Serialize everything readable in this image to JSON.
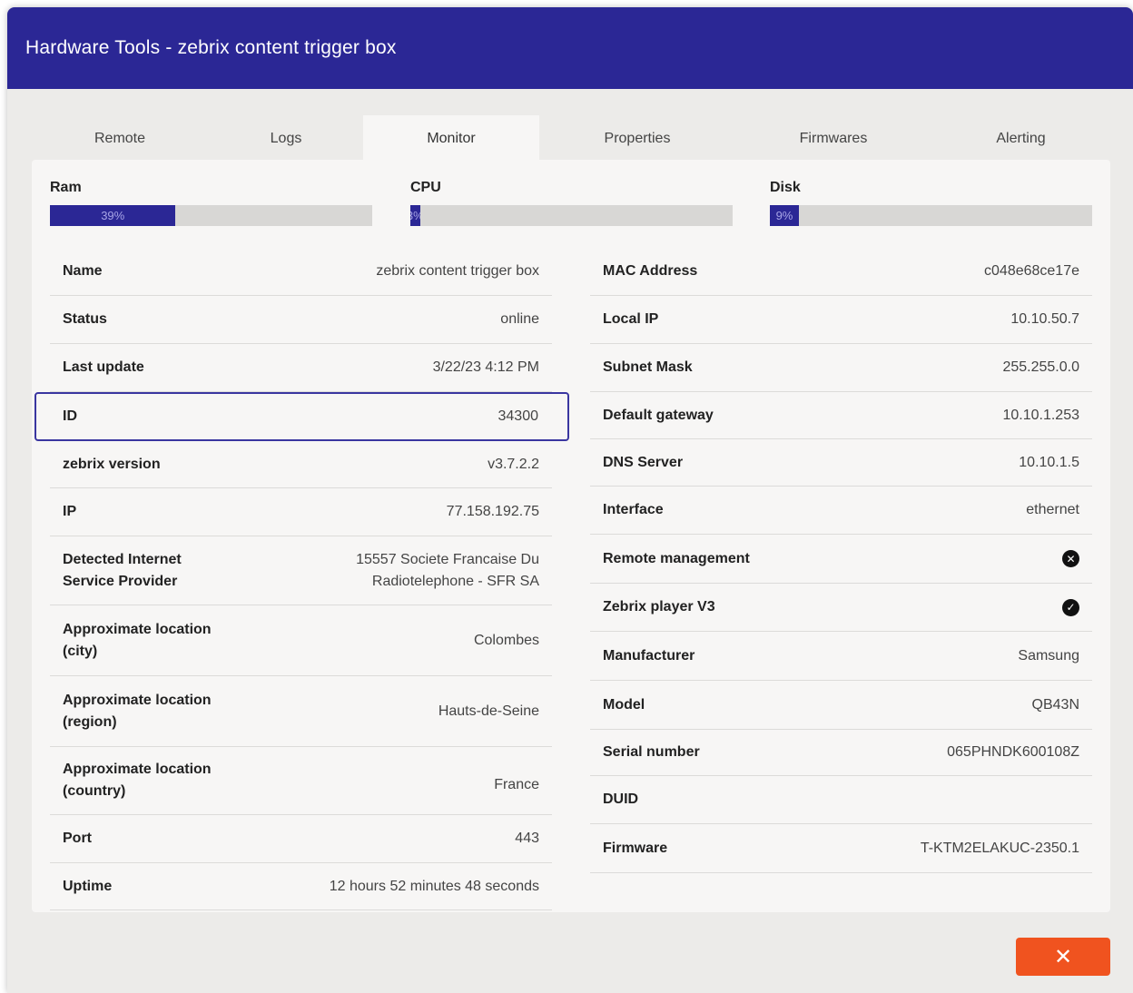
{
  "dialog": {
    "title": "Hardware Tools - zebrix content trigger box",
    "close_label": "✕"
  },
  "tabs": [
    {
      "label": "Remote"
    },
    {
      "label": "Logs"
    },
    {
      "label": "Monitor",
      "active": true
    },
    {
      "label": "Properties"
    },
    {
      "label": "Firmwares"
    },
    {
      "label": "Alerting"
    }
  ],
  "meters": {
    "ram": {
      "label": "Ram",
      "percent": 39,
      "text": "39%"
    },
    "cpu": {
      "label": "CPU",
      "percent": 3,
      "text": "3%"
    },
    "disk": {
      "label": "Disk",
      "percent": 9,
      "text": "9%"
    }
  },
  "left": {
    "name": {
      "label": "Name",
      "value": "zebrix content trigger box"
    },
    "status": {
      "label": "Status",
      "value": "online"
    },
    "last_update": {
      "label": "Last update",
      "value": "3/22/23 4:12 PM"
    },
    "id": {
      "label": "ID",
      "value": "34300"
    },
    "version": {
      "label": "zebrix version",
      "value": "v3.7.2.2"
    },
    "ip": {
      "label": "IP",
      "value": "77.158.192.75"
    },
    "isp": {
      "label_1": "Detected Internet",
      "label_2": "Service Provider",
      "value_1": "15557 Societe Francaise Du",
      "value_2": "Radiotelephone - SFR SA"
    },
    "city": {
      "label_1": "Approximate location",
      "label_2": "(city)",
      "value": "Colombes"
    },
    "region": {
      "label_1": "Approximate location",
      "label_2": "(region)",
      "value": "Hauts-de-Seine"
    },
    "country": {
      "label_1": "Approximate location",
      "label_2": "(country)",
      "value": "France"
    },
    "port": {
      "label": "Port",
      "value": "443"
    },
    "uptime": {
      "label": "Uptime",
      "value": "12 hours 52 minutes 48 seconds"
    }
  },
  "right": {
    "mac": {
      "label": "MAC Address",
      "value": "c048e68ce17e"
    },
    "local_ip": {
      "label": "Local IP",
      "value": "10.10.50.7"
    },
    "subnet": {
      "label": "Subnet Mask",
      "value": "255.255.0.0"
    },
    "gateway": {
      "label": "Default gateway",
      "value": "10.10.1.253"
    },
    "dns": {
      "label": "DNS Server",
      "value": "10.10.1.5"
    },
    "interface": {
      "label": "Interface",
      "value": "ethernet"
    },
    "remote_mgmt": {
      "label": "Remote management",
      "icon": "x-circle-icon",
      "glyph": "✕",
      "enabled": false
    },
    "player_v3": {
      "label": "Zebrix player V3",
      "icon": "check-circle-icon",
      "glyph": "✓",
      "enabled": true
    },
    "manufacturer": {
      "label": "Manufacturer",
      "value": "Samsung"
    },
    "model": {
      "label": "Model",
      "value": "QB43N"
    },
    "serial": {
      "label": "Serial number",
      "value": "065PHNDK600108Z"
    },
    "duid": {
      "label": "DUID",
      "value": ""
    },
    "firmware": {
      "label": "Firmware",
      "value": "T-KTM2ELAKUC-2350.1"
    }
  },
  "colors": {
    "header": "#2b2795",
    "accent": "#2b2795",
    "close_button": "#f0531f",
    "panel": "#f7f6f5",
    "background": "#ecebe9"
  }
}
